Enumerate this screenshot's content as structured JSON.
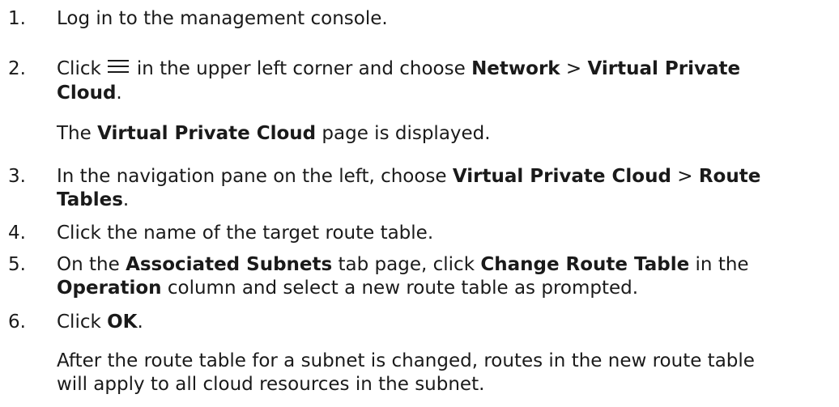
{
  "steps": [
    {
      "number": "1.",
      "text": "Log in to the management console."
    },
    {
      "number": "2.",
      "pre_icon": "Click",
      "icon": "hamburger-menu-icon",
      "post_icon": "in the upper left corner and choose",
      "bold_1": "Network",
      "sep_1": ">",
      "bold_2a": "Virtual Private",
      "bold_2b": "Cloud",
      "end": ".",
      "result_bold": "Virtual Private Cloud",
      "result_pre": "The",
      "result_post": "page is displayed."
    },
    {
      "number": "3.",
      "pre": "In the navigation pane on the left, choose",
      "bold_1": "Virtual Private Cloud",
      "sep_1": ">",
      "bold_2a": "Route",
      "bold_2b": "Tables",
      "end": "."
    },
    {
      "number": "4.",
      "text": "Click the name of the target route table."
    },
    {
      "number": "5.",
      "pre": "On the",
      "bold_1": "Associated Subnets",
      "mid_1": "tab page, click",
      "bold_2": "Change Route Table",
      "mid_2": "in the",
      "bold_3": "Operation",
      "post": "column and select a new route table as prompted."
    },
    {
      "number": "6.",
      "pre": "Click",
      "bold_1": "OK",
      "end": ".",
      "result_line_1": "After the route table for a subnet is changed, routes in the new route table",
      "result_line_2": "will apply to all cloud resources in the subnet."
    }
  ]
}
